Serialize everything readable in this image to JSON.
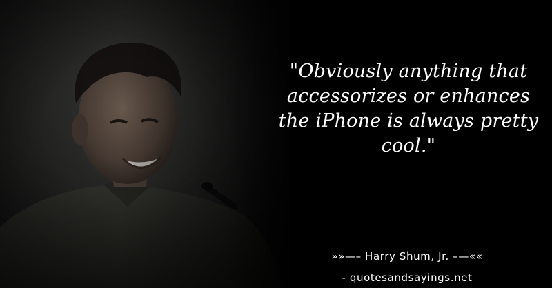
{
  "quote": {
    "text": "\"Obviously anything that accessorizes or enhances the iPhone is always pretty cool.\""
  },
  "attribution": {
    "author_line": "»»—– Harry Shum, Jr. –—««",
    "site": "- quotesandsayings.net"
  },
  "colors": {
    "background": "#000000",
    "text": "#ffffff"
  }
}
